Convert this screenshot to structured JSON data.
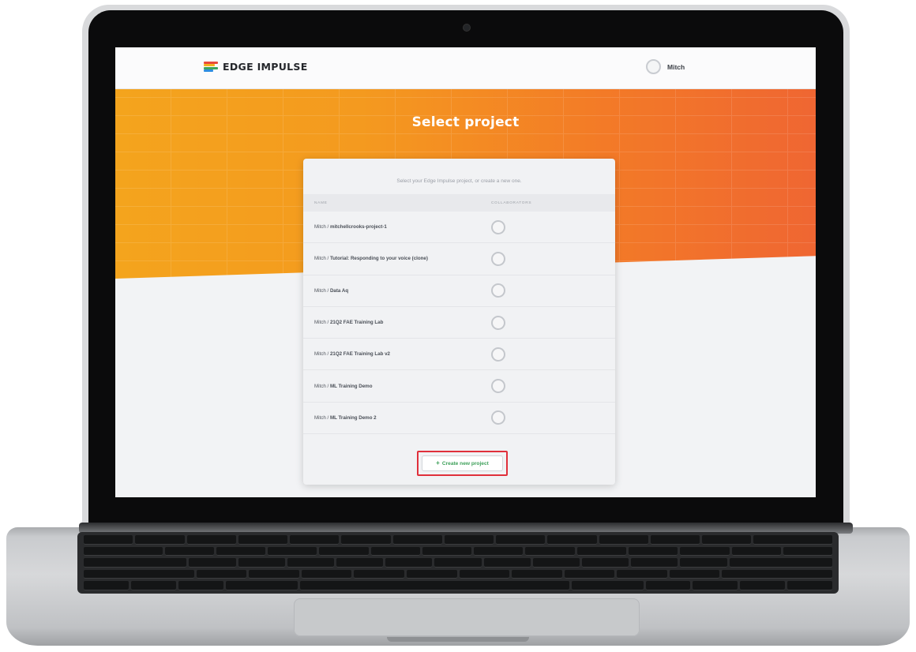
{
  "app": {
    "brand": "EDGE IMPULSE",
    "brand_colors": [
      "#e84a3b",
      "#f4b21f",
      "#3da45c",
      "#2d8ee0"
    ],
    "accent": "#f49a1f"
  },
  "header": {
    "user_name": "Mitch"
  },
  "page": {
    "title": "Select project",
    "intro": "Select your Edge Impulse project, or create a new one."
  },
  "table": {
    "col_name": "NAME",
    "col_collaborators": "COLLABORATORS",
    "rows": [
      {
        "owner": "Mitch / ",
        "project": "mitchellcrooks-project-1"
      },
      {
        "owner": "Mitch / ",
        "project": "Tutorial: Responding to your voice (clone)"
      },
      {
        "owner": "Mitch / ",
        "project": "Data Aq"
      },
      {
        "owner": "Mitch / ",
        "project": "21Q2 FAE Training Lab"
      },
      {
        "owner": "Mitch / ",
        "project": "21Q2 FAE Training Lab v2"
      },
      {
        "owner": "Mitch / ",
        "project": "ML Training Demo"
      },
      {
        "owner": "Mitch / ",
        "project": "ML Training Demo 2"
      }
    ]
  },
  "actions": {
    "create_icon": "plus-icon",
    "create_label": "Create new project",
    "create_color": "#3ea05a",
    "highlight_color": "#e0303b"
  }
}
